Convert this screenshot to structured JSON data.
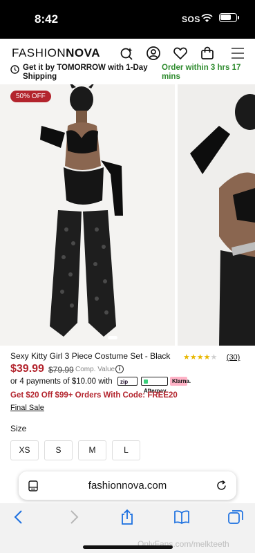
{
  "status_bar": {
    "time": "8:42",
    "sos": "SOS",
    "icons": [
      "wifi-icon",
      "battery-icon"
    ]
  },
  "header": {
    "logo_part1": "FASHION",
    "logo_part2": "NOVA",
    "icons": [
      "find-similar-icon",
      "account-icon",
      "heart-icon",
      "bag-icon",
      "menu-icon"
    ]
  },
  "shipping": {
    "message": "Get it by TOMORROW with 1-Day Shipping",
    "countdown": "Order within 3 hrs 17 mins",
    "countdown_color": "#2e8b2e"
  },
  "gallery": {
    "badge": "50% OFF",
    "badge_color": "#b3242d"
  },
  "product": {
    "name": "Sexy Kitty Girl 3 Piece Costume Set - Black",
    "rating_stars": 4,
    "rating_max": 5,
    "review_count": "(30)",
    "price": "$39.99",
    "old_price": "$79.99",
    "comp_value_label": "Comp. Value",
    "installments": "or 4 payments of $10.00 with",
    "pay_options": [
      "zip",
      "Afterpay",
      "Klarna."
    ],
    "promo": "Get $20 Off $99+ Orders With Code: FREE20",
    "final_sale": "Final Sale",
    "size_label": "Size",
    "sizes": [
      "XS",
      "S",
      "M",
      "L"
    ],
    "price_color": "#b3242d"
  },
  "browser": {
    "url": "fashionnova.com"
  },
  "watermark": "OnlyFans.com/melkteeth"
}
